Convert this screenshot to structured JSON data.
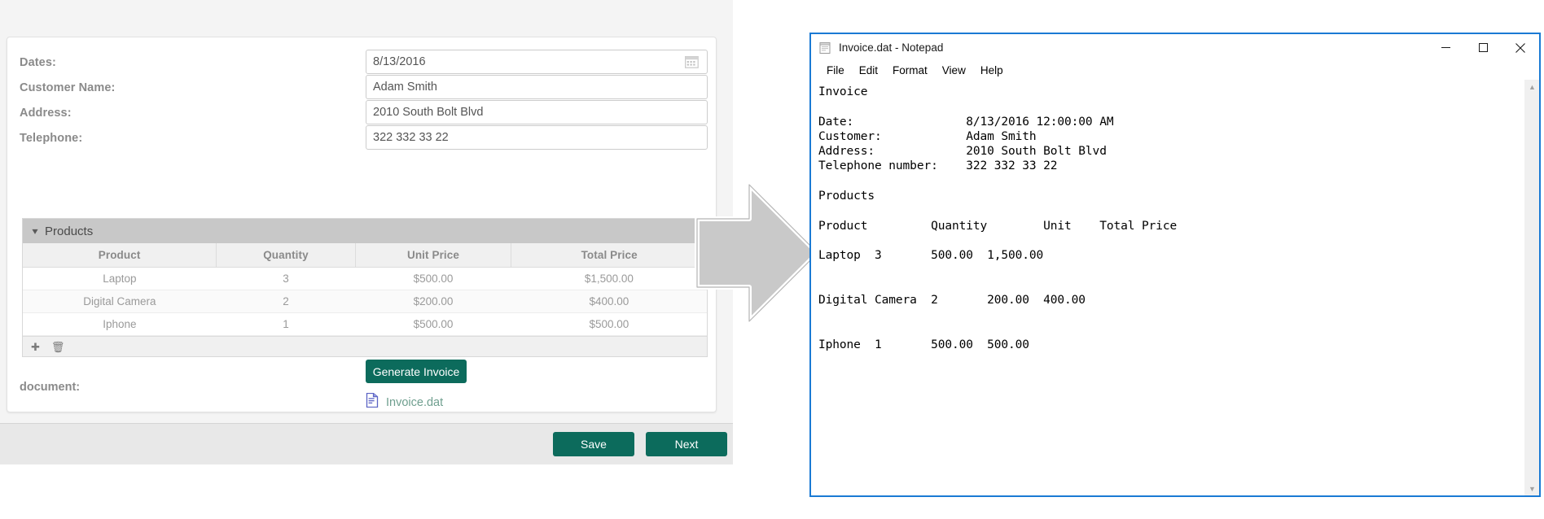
{
  "form": {
    "fields": [
      {
        "label": "Dates:",
        "value": "8/13/2016",
        "placeholder": "",
        "has_calendar": true
      },
      {
        "label": "Customer Name:",
        "value": "Adam Smith",
        "placeholder": "",
        "has_calendar": false
      },
      {
        "label": "Address:",
        "value": "2010 South Bolt Blvd",
        "placeholder": "",
        "has_calendar": false
      },
      {
        "label": "Telephone:",
        "value": "322 332 33 22",
        "placeholder": "",
        "has_calendar": false
      }
    ],
    "products_section_title": "Products",
    "products_columns": [
      "Product",
      "Quantity",
      "Unit Price",
      "Total Price"
    ],
    "products_rows": [
      {
        "product": "Laptop",
        "quantity": "3",
        "unit_price": "$500.00",
        "total_price": "$1,500.00"
      },
      {
        "product": "Digital Camera",
        "quantity": "2",
        "unit_price": "$200.00",
        "total_price": "$400.00"
      },
      {
        "product": "Iphone",
        "quantity": "1",
        "unit_price": "$500.00",
        "total_price": "$500.00"
      }
    ],
    "grid_toolbar": {
      "add_icon": "plus-icon",
      "delete_icon": "trash-icon"
    },
    "generate_button": "Generate Invoice",
    "document_label": "document:",
    "document_link": "Invoice.dat",
    "document_icon": "dat-file-icon",
    "footer": {
      "save": "Save",
      "next": "Next"
    },
    "accent_color": "#0c6b5c",
    "link_color": "#6f9f8f"
  },
  "arrow": {
    "name": "right-arrow",
    "fill": "#c9c9c9",
    "stroke": "#ffffff"
  },
  "notepad": {
    "title": "Invoice.dat - Notepad",
    "app_icon": "notepad-icon",
    "menus": [
      "File",
      "Edit",
      "Format",
      "View",
      "Help"
    ],
    "window_controls": {
      "minimize": "─",
      "maximize": "☐",
      "close": "✕"
    },
    "border_color": "#1a7ad4",
    "scrollbar": {
      "up": "▲",
      "down": "▼"
    },
    "content": "Invoice\n\nDate:                8/13/2016 12:00:00 AM\nCustomer:            Adam Smith\nAddress:             2010 South Bolt Blvd\nTelephone number:    322 332 33 22\n\nProducts\n\nProduct         Quantity        Unit    Total Price\n\nLaptop  3       500.00  1,500.00\n\n\nDigital Camera  2       200.00  400.00\n\n\nIphone  1       500.00  500.00"
  }
}
